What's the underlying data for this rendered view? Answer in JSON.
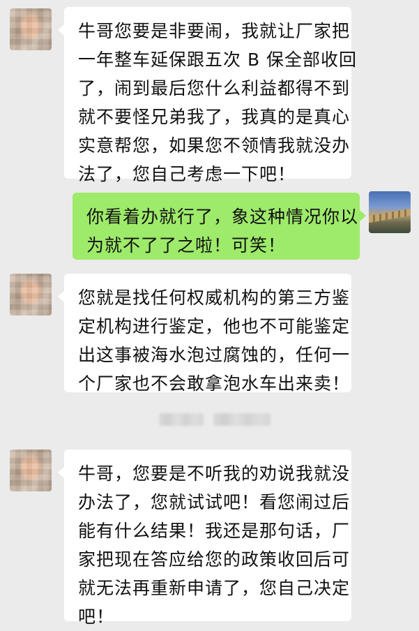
{
  "messages": [
    {
      "side": "left",
      "lines": [
        "牛哥您要是非要闹，我就让厂家把",
        "一年整车延保跟五次 B 保全部收回",
        "了，闹到最后您什么利益都得不到",
        "就不要怪兄弟我了，我真的是真心",
        "实意帮您，如果您不领情我就没办",
        "法了，您自己考虑一下吧！"
      ]
    },
    {
      "side": "right",
      "lines": [
        "你看着办就行了，象这种情况你以",
        "为就不了了之啦！可笑！"
      ]
    },
    {
      "side": "left",
      "lines": [
        "您就是找任何权威机构的第三方鉴",
        "定机构进行鉴定，他也不可能鉴定",
        "出这事被海水泡过腐蚀的，任何一",
        "个厂家也不会敢拿泡水车出来卖！"
      ]
    },
    {
      "side": "left",
      "lines": [
        "牛哥，您要是不听我的劝说我就没",
        "办法了，您就试试吧！看您闹过后",
        "能有什么结果！我还是那句话，厂",
        "家把现在答应给您的政策收回后可",
        "就无法再重新申请了，您自己决定",
        "吧！"
      ]
    }
  ],
  "colors": {
    "background": "#ebebeb",
    "incoming_bubble": "#ffffff",
    "outgoing_bubble": "#9eea6a"
  },
  "icons": {
    "left_avatar": "blurred-contact-avatar",
    "right_avatar": "great-wall-landscape-avatar"
  }
}
